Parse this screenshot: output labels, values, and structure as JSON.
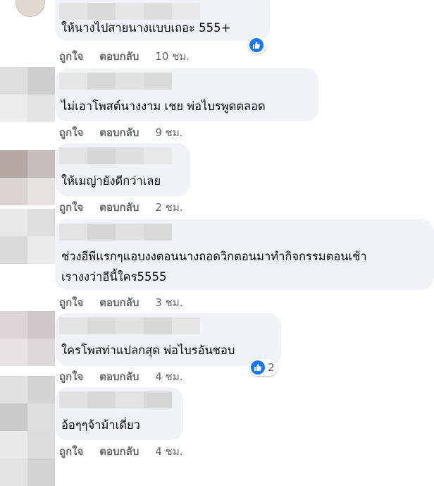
{
  "comments": [
    {
      "text_lines": [
        "ให้นางไปสายนางแบบเถอะ 555+"
      ],
      "like": "ถูกใจ",
      "reply": "ตอบกลับ",
      "time": "10 ชม.",
      "reaction_count": ""
    },
    {
      "text_lines": [
        "ไม่เอาโพสต์นางงาม เชย พ่อไบรพูดตลอด"
      ],
      "like": "ถูกใจ",
      "reply": "ตอบกลับ",
      "time": "9 ชม.",
      "reaction_count": ""
    },
    {
      "text_lines": [
        "ให้เมญ่ายังดีกว่าเลย"
      ],
      "like": "ถูกใจ",
      "reply": "ตอบกลับ",
      "time": "2 ชม.",
      "reaction_count": ""
    },
    {
      "text_lines": [
        "ช่วงอีพีแรกๆแอบงงตอนนางถอดวิกตอนมาทำกิจกรรมตอนเช้า",
        "เรางงว่าอีนี้ใคร5555"
      ],
      "like": "ถูกใจ",
      "reply": "ตอบกลับ",
      "time": "3 ชม.",
      "reaction_count": ""
    },
    {
      "text_lines": [
        "ใครโพสท่าแปลกสุด พ่อไบรอันชอบ"
      ],
      "like": "ถูกใจ",
      "reply": "ตอบกลับ",
      "time": "4 ชม.",
      "reaction_count": "2"
    },
    {
      "text_lines": [
        "อ้อๆๆจ้าม้าเดี่ยว"
      ],
      "like": "ถูกใจ",
      "reply": "ตอบกลับ",
      "time": "4 ชม.",
      "reaction_count": ""
    }
  ],
  "colors": {
    "bubble": "#f0f2f5",
    "secondary_text": "#65676b",
    "like_blue": "#1877f2"
  },
  "icons": [
    "like-icon"
  ]
}
